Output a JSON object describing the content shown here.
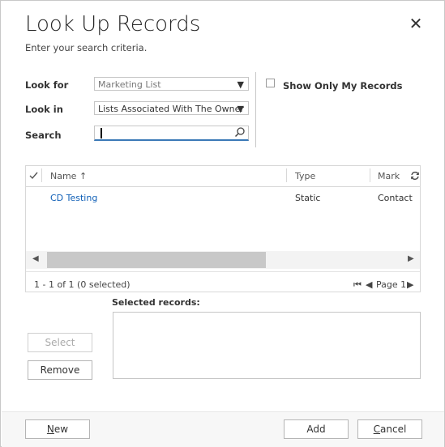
{
  "dialog": {
    "title": "Look Up Records",
    "subtitle": "Enter your search criteria.",
    "close_glyph": "✕"
  },
  "form": {
    "look_for_label": "Look for",
    "look_for_value": "Marketing List",
    "look_in_label": "Look in",
    "look_in_value": "Lists Associated With The Owner",
    "search_label": "Search",
    "search_value": "",
    "show_only_mine_label": "Show Only My Records",
    "show_only_mine_checked": false
  },
  "grid": {
    "columns": [
      "Name",
      "Type",
      "Mark"
    ],
    "sort_indicator": "↑",
    "rows": [
      {
        "name": "CD Testing",
        "type": "Static",
        "mark": "Contact"
      }
    ],
    "count_text": "1 - 1 of 1 (0 selected)",
    "page_text": "Page 1",
    "scroll_fraction": 0.55
  },
  "selected": {
    "label": "Selected records:",
    "select_button": "Select",
    "remove_button": "Remove"
  },
  "footer": {
    "new_button_first": "N",
    "new_button_rest": "ew",
    "add_button": "Add",
    "cancel_button_first": "C",
    "cancel_button_rest": "ancel"
  },
  "icons": {
    "dropdown": "dropdown-arrow-icon",
    "search": "magnifier-icon",
    "refresh": "refresh-icon",
    "check": "checkmark-icon"
  },
  "colors": {
    "accent": "#3b79b7",
    "link": "#1160b7"
  }
}
